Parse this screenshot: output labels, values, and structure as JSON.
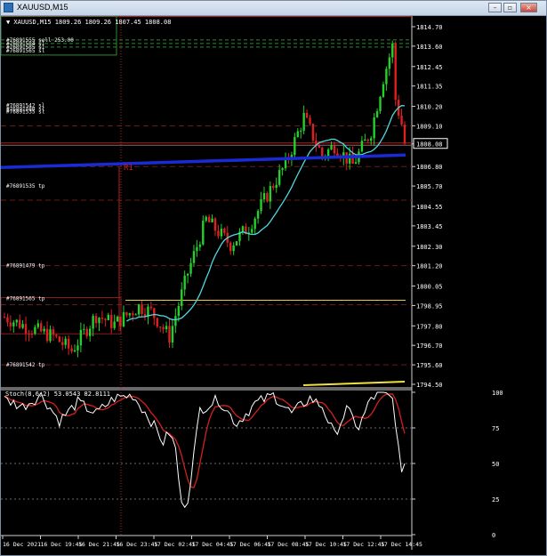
{
  "window": {
    "title": "XAUUSD,M15"
  },
  "header": {
    "info": "▼ XAUUSD,M15  1809.26 1809.26 1807.45 1808.08"
  },
  "chart_data": {
    "type": "candlestick",
    "symbol": "XAUUSD",
    "timeframe": "M15",
    "last_price": "1808.08",
    "price_axis": [
      "1814.70",
      "1813.60",
      "1812.45",
      "1811.35",
      "1810.20",
      "1809.10",
      "1808.08",
      "1806.80",
      "1805.70",
      "1804.55",
      "1803.45",
      "1802.30",
      "1801.20",
      "1800.05",
      "1798.95",
      "1797.80",
      "1796.70",
      "1795.60",
      "1794.50"
    ],
    "osc_axis": [
      "100",
      "75",
      "50",
      "25",
      "0"
    ],
    "time_axis": [
      "16 Dec 2021",
      "16 Dec 19:45",
      "16 Dec 21:45",
      "16 Dec 23:45",
      "17 Dec 02:45",
      "17 Dec 04:45",
      "17 Dec 06:45",
      "17 Dec 08:45",
      "17 Dec 10:45",
      "17 Dec 12:45",
      "17 Dec 14:45"
    ],
    "oscillator_label": "Stoch(8,6,2) 53.0543 82.8111",
    "pivot_label": "R1",
    "order_labels": [
      {
        "text": "#76891555 sell 253.00",
        "price": 1813.95
      },
      {
        "text": "#76891584 sl",
        "price": 1813.75
      },
      {
        "text": "#76891585 sl",
        "price": 1813.55
      },
      {
        "text": "#76891565 sl",
        "price": 1813.35
      },
      {
        "text": "#76891542 sl",
        "price": 1810.25
      },
      {
        "text": "#76891480 sl",
        "price": 1810.05
      },
      {
        "text": "#76891535 sl",
        "price": 1809.9
      },
      {
        "text": "#76891535 tp",
        "price": 1805.7
      },
      {
        "text": "#76891479 tp",
        "price": 1801.2
      },
      {
        "text": "#76891565 tp",
        "price": 1799.35
      },
      {
        "text": "#76891542 tp",
        "price": 1795.6
      }
    ],
    "red_dashed_levels": [
      1809.1,
      1806.8,
      1804.9,
      1801.2,
      1799.0,
      1795.6
    ],
    "colors": {
      "background": "#000000",
      "bull": "#22d12a",
      "bear": "#e02020",
      "ma": "#4fd8e0",
      "trend": "#1a2bd6",
      "stoch_main": "#ffffff",
      "stoch_signal": "#d42020",
      "grid_dash": "#6b1a1a"
    }
  }
}
